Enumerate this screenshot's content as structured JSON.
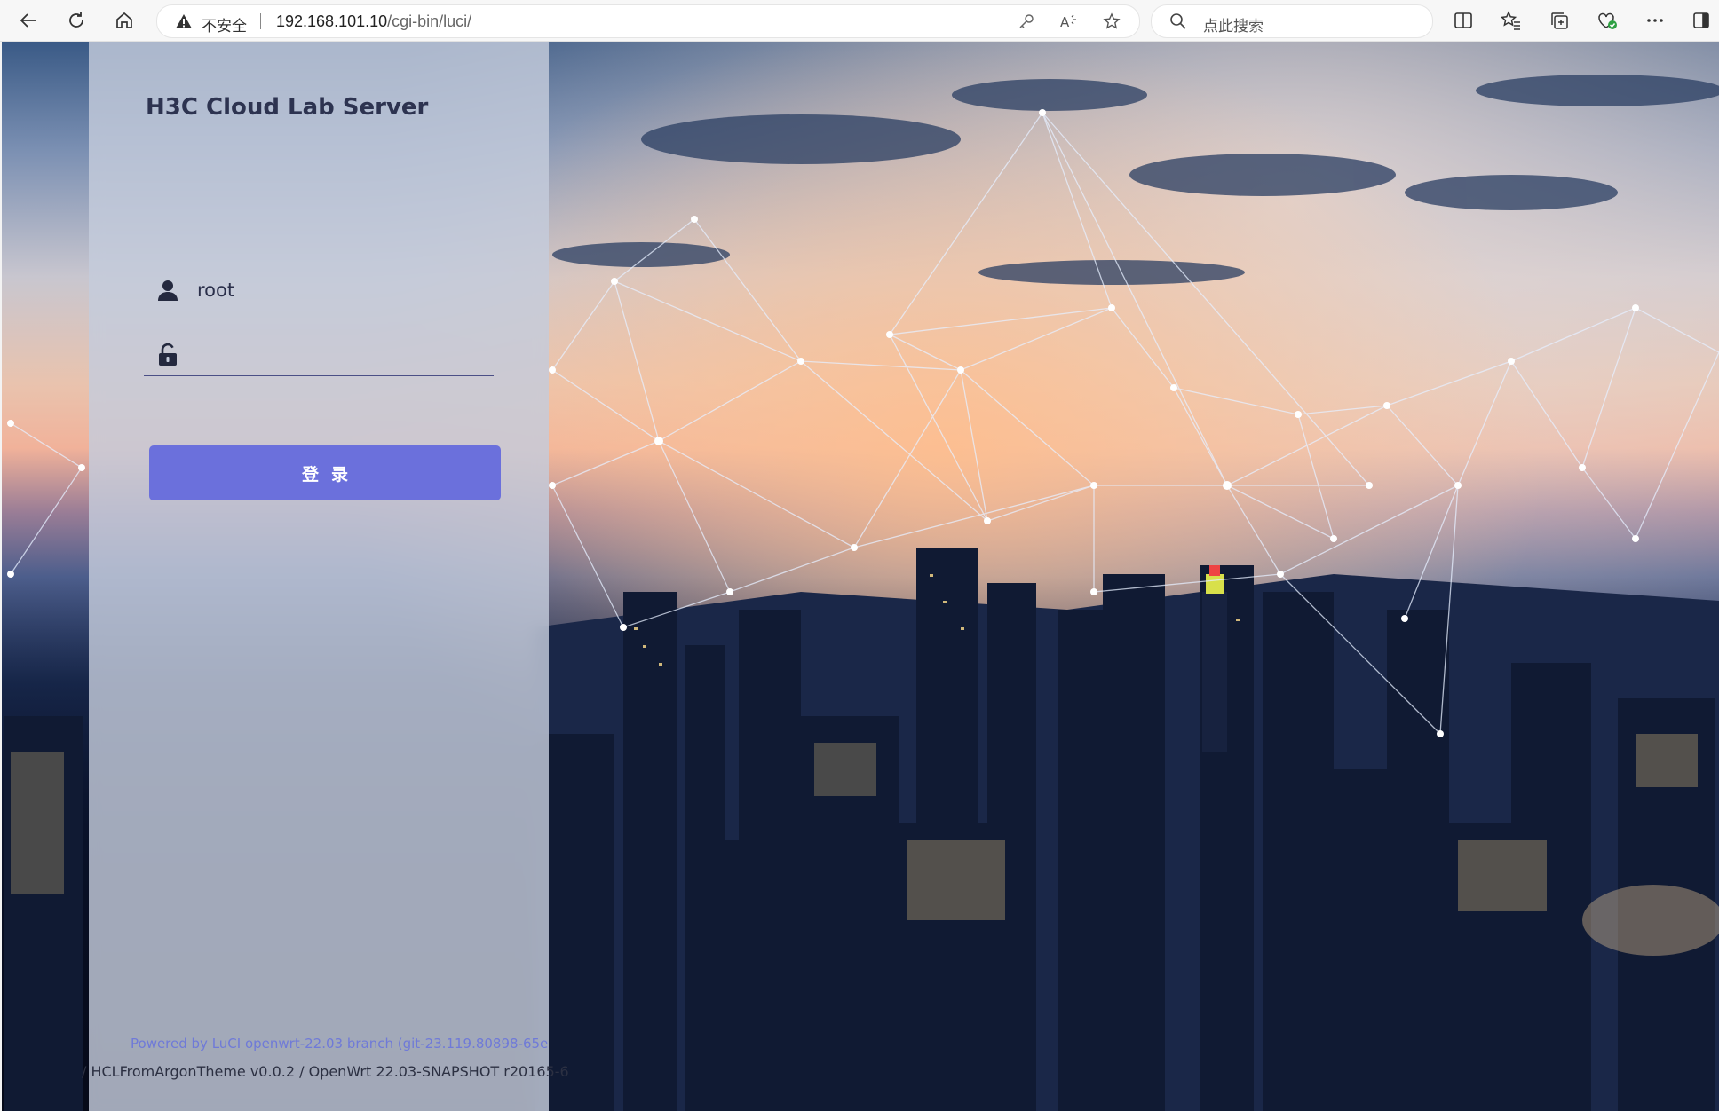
{
  "browser": {
    "address_bar": {
      "security_label": "不安全",
      "url_host": "192.168.101.10",
      "url_path": "/cgi-bin/luci/"
    },
    "search_box": {
      "placeholder": "点此搜索"
    },
    "icons": [
      "back-icon",
      "refresh-icon",
      "home-icon",
      "warning-icon",
      "key-icon",
      "read-aloud-icon",
      "favorite-star-icon",
      "search-icon",
      "split-screen-icon",
      "favorites-icon",
      "collections-icon",
      "browser-essentials-icon",
      "more-icon",
      "sidebar-icon"
    ]
  },
  "login": {
    "brand": "H3C Cloud Lab Server",
    "username_value": "root",
    "password_value": "",
    "submit_label": "登录",
    "footer_powered": "Powered by LuCI openwrt-22.03 branch (git-23.119.80898-65e",
    "footer_version": "/ HCLFromArgonTheme v0.0.2 / OpenWrt 22.03-SNAPSHOT r20165-6"
  },
  "colors": {
    "accent_button": "#6b70dc",
    "brand_text": "#2d3350",
    "footer_link": "#6f7ad8"
  }
}
